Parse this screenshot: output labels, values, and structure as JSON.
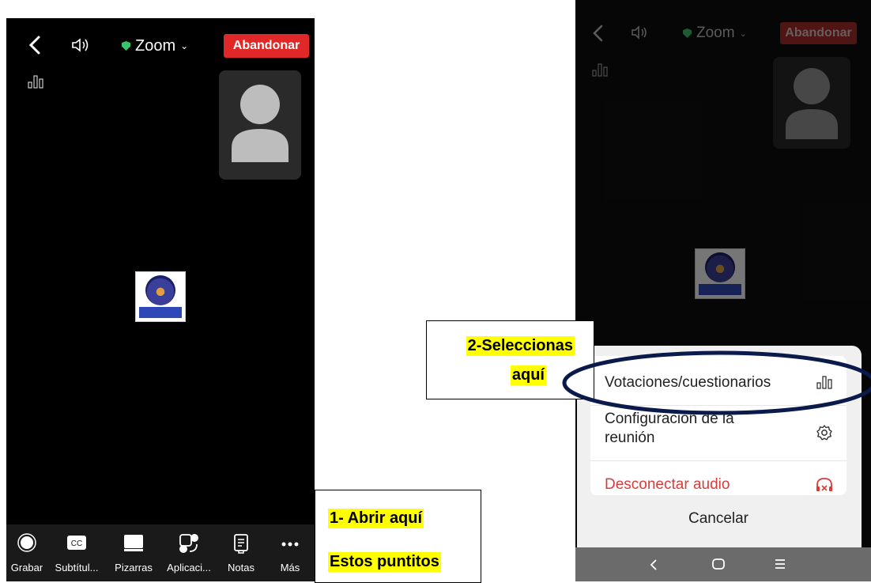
{
  "left_phone": {
    "leave_label": "Abandonar",
    "meeting_title": "Zoom",
    "toolbar": [
      {
        "label": "Grabar",
        "icon": "record-icon"
      },
      {
        "label": "Subtítul...",
        "icon": "cc-icon"
      },
      {
        "label": "Pizarras",
        "icon": "whiteboard-icon"
      },
      {
        "label": "Aplicaci...",
        "icon": "apps-icon"
      },
      {
        "label": "Notas",
        "icon": "notes-icon"
      },
      {
        "label": "Más",
        "icon": "more-icon"
      }
    ]
  },
  "annotations": {
    "step1_line1": "1- Abrir aquí",
    "step1_line2": "Estos puntitos",
    "step2_line1": "2-Seleccionas",
    "step2_line2": "aquí"
  },
  "right_phone": {
    "leave_label": "Abandonar",
    "meeting_title": "Zoom",
    "menu": {
      "polls_label": "Votaciones/cuestionarios",
      "settings_label": "Configuración de la reunión",
      "disconnect_label": "Desconectar audio",
      "cancel_label": "Cancelar"
    },
    "accent_color": "#d93b3b"
  }
}
